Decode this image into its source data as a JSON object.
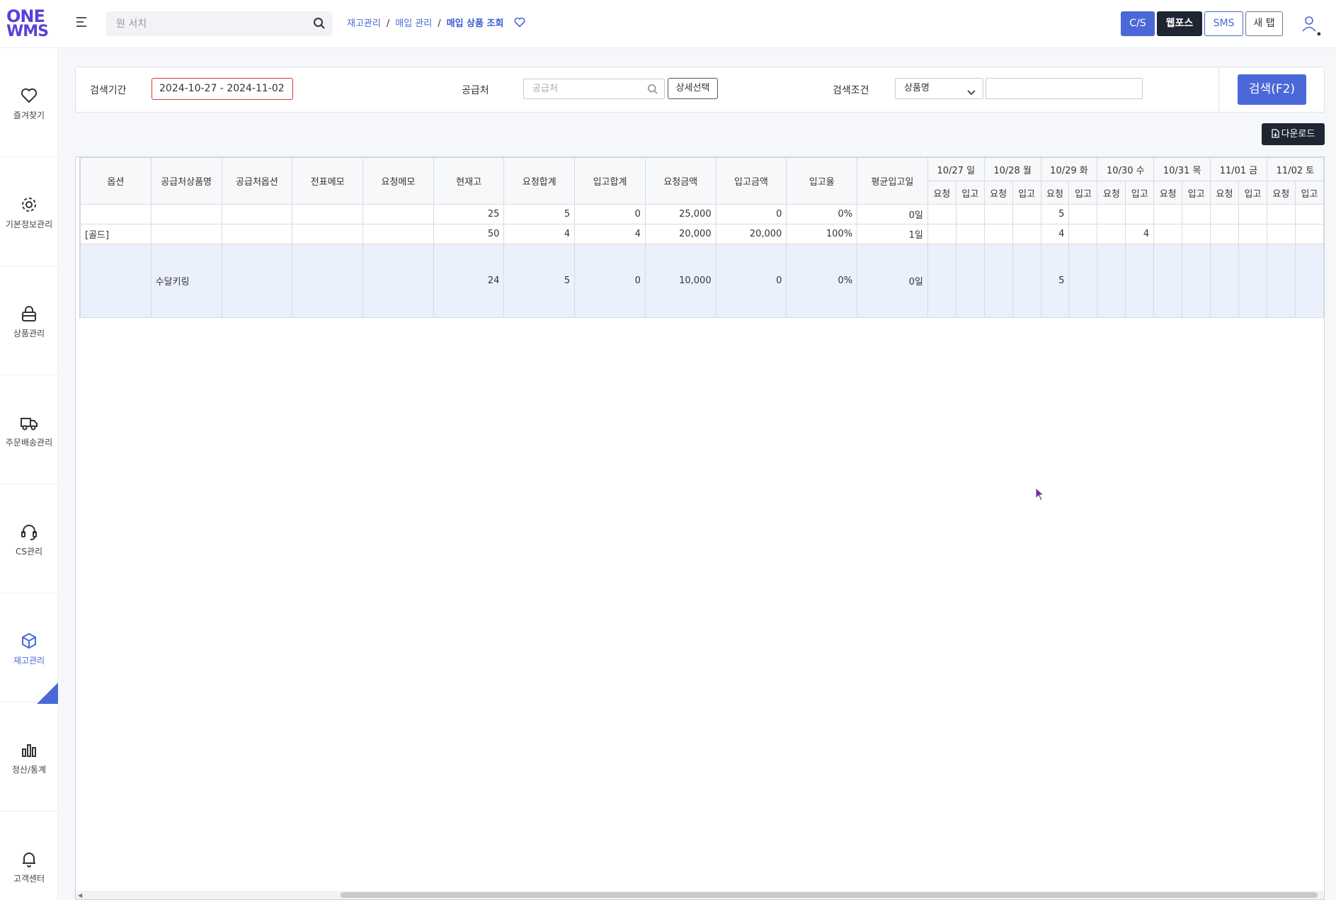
{
  "app": {
    "logo_line1": "ONE",
    "logo_line2": "WMS",
    "search_placeholder": "원 서치",
    "breadcrumb": [
      "재고관리",
      "매입 관리",
      "매입 상품 조회"
    ],
    "buttons": {
      "cs": "C/S",
      "web": "웹포스",
      "sms": "SMS",
      "newtab": "새 탭"
    }
  },
  "sidebar": {
    "items": [
      {
        "label": "즐겨찾기",
        "icon": "heart-icon"
      },
      {
        "label": "기본정보관리",
        "icon": "gear-icon"
      },
      {
        "label": "상품관리",
        "icon": "bag-icon"
      },
      {
        "label": "주문배송관리",
        "icon": "truck-icon"
      },
      {
        "label": "CS관리",
        "icon": "headset-icon"
      },
      {
        "label": "재고관리",
        "icon": "box-icon"
      },
      {
        "label": "정산/통계",
        "icon": "bar-chart-icon"
      },
      {
        "label": "고객센터",
        "icon": "bell-icon"
      }
    ],
    "active": "재고관리"
  },
  "filter": {
    "period_label": "검색기간",
    "period_value": "2024-10-27 - 2024-11-02",
    "supplier_label": "공급처",
    "supplier_placeholder": "공급처",
    "detail_button": "상세선택",
    "condition_label": "검색조건",
    "condition_value": "상품명",
    "condition_input": "",
    "search_button": "검색(F2)"
  },
  "download_button": "다운로드",
  "table": {
    "columns": [
      "옵션",
      "공급처상품명",
      "공급처옵션",
      "전표메모",
      "요청메모",
      "현재고",
      "요청합계",
      "입고합계",
      "요청금액",
      "입고금액",
      "입고율",
      "평균입고일"
    ],
    "dates": [
      "10/27 일",
      "10/28 월",
      "10/29 화",
      "10/30 수",
      "10/31 목",
      "11/01 금",
      "11/02 토"
    ],
    "sub_request": "요청",
    "sub_receive": "입고",
    "rows": [
      {
        "cells": [
          "",
          "",
          "",
          "",
          "",
          "25",
          "5",
          "0",
          "25,000",
          "0",
          "0%",
          "0일"
        ],
        "daily": [
          "",
          "",
          "",
          "",
          "5",
          "",
          "",
          "",
          "",
          "",
          "",
          "",
          "",
          ""
        ]
      },
      {
        "cells": [
          "[골드]",
          "",
          "",
          "",
          "",
          "50",
          "4",
          "4",
          "20,000",
          "20,000",
          "100%",
          "1일"
        ],
        "daily": [
          "",
          "",
          "",
          "",
          "4",
          "",
          "",
          "4",
          "",
          "",
          "",
          "",
          "",
          ""
        ]
      },
      {
        "cells": [
          "",
          "수달키링",
          "",
          "",
          "",
          "24",
          "5",
          "0",
          "10,000",
          "0",
          "0%",
          "0일"
        ],
        "daily": [
          "",
          "",
          "",
          "",
          "5",
          "",
          "",
          "",
          "",
          "",
          "",
          "",
          "",
          ""
        ]
      }
    ]
  },
  "colors": {
    "accent": "#4a68d8",
    "dark": "#1f2532",
    "selected_row": "#ebf0fd"
  }
}
